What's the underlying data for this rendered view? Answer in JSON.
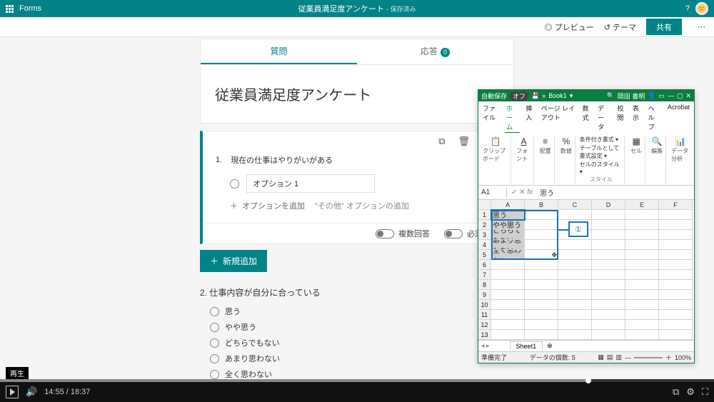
{
  "header": {
    "app": "Forms",
    "doc_title": "従業員満足度アンケート",
    "saved": "- 保存済み"
  },
  "subheader": {
    "preview": "プレビュー",
    "theme": "テーマ",
    "share": "共有"
  },
  "tabs": {
    "questions": "質問",
    "responses": "応答",
    "response_count": "0"
  },
  "form": {
    "title": "従業員満足度アンケート",
    "q1": {
      "number": "1.",
      "text": "現在の仕事はやりがいがある",
      "option1_label": "オプション 1",
      "add_option": "オプションを追加",
      "other_option": "\"その他\" オプションの追加",
      "multi": "複数回答",
      "required": "必須"
    },
    "add_new": "新規追加",
    "q2": {
      "number": "2.",
      "text": "仕事内容が自分に合っている",
      "opts": [
        "思う",
        "やや思う",
        "どちらでもない",
        "あまり思わない",
        "全く思わない"
      ]
    }
  },
  "excel": {
    "autosave": "自動保存",
    "autosave_state": "オフ",
    "book": "Book1",
    "user": "岡田 書明",
    "tabs": [
      "ファイル",
      "ホーム",
      "挿入",
      "ページ レイアウト",
      "数式",
      "データ",
      "校閲",
      "表示",
      "ヘルプ",
      "Acrobat"
    ],
    "groups": {
      "clipboard": "クリップボード",
      "font": "フォント",
      "align": "配置",
      "number": "数値",
      "cond": "条件付き書式 ▾",
      "tblfmt": "テーブルとして書式設定 ▾",
      "cellstyle": "セルのスタイル ▾",
      "styles": "スタイル",
      "cells": "セル",
      "edit": "編集",
      "analysis": "データ分析"
    },
    "name_box": "A1",
    "formula_value": "思う",
    "cols": [
      "A",
      "B",
      "C",
      "D",
      "E",
      "F"
    ],
    "cells": [
      "思う",
      "やや思う",
      "どちらでもない",
      "あまり思わない",
      "全く思わない"
    ],
    "sheet": "Sheet1",
    "status_ready": "準備完了",
    "status_count": "データの個数: 5",
    "zoom": "100%"
  },
  "callout": "①",
  "player": {
    "play_label": "再生",
    "time": "14:55 / 18:37"
  },
  "chart_data": null
}
